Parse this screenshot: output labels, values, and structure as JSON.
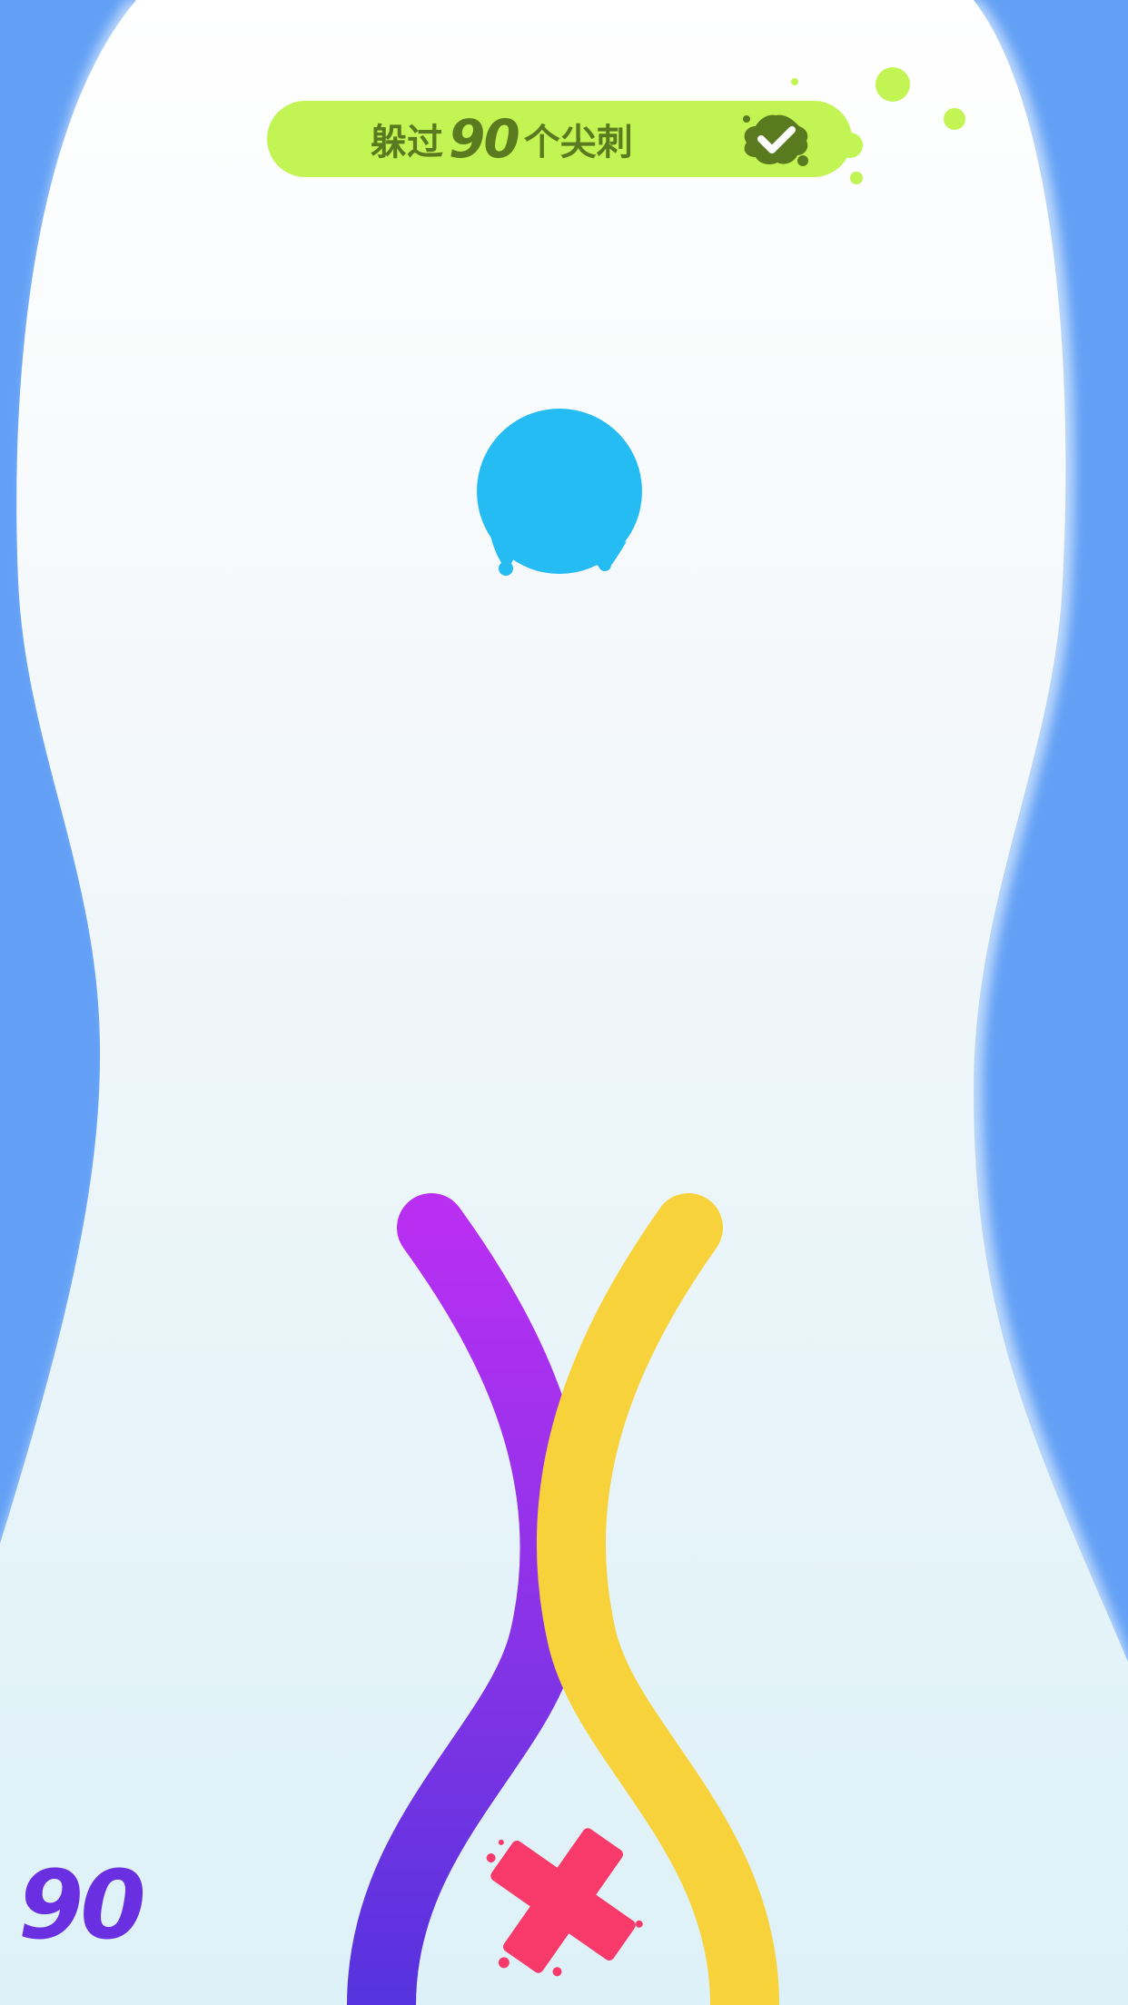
{
  "objective": {
    "prefix": "躲过",
    "count": "90",
    "suffix": "个尖刺",
    "status_icon": "check-splat-icon",
    "completed": true
  },
  "score": {
    "value": "90"
  },
  "player": {
    "ball_color": "#25bcf3"
  },
  "snakes": [
    {
      "name": "purple",
      "color_top": "#b12ff0",
      "color_bottom": "#5b35e0"
    },
    {
      "name": "yellow",
      "color": "#f8d23a"
    }
  ],
  "hazard": {
    "icon": "x-mark-icon",
    "color": "#f73a6a"
  },
  "colors": {
    "wall": "#63a0f5",
    "track_top": "#ffffff",
    "track_bottom": "#dff2f8",
    "banner": "#c2f553",
    "banner_text": "#5a7a1f",
    "score": "#6a2fe0"
  }
}
